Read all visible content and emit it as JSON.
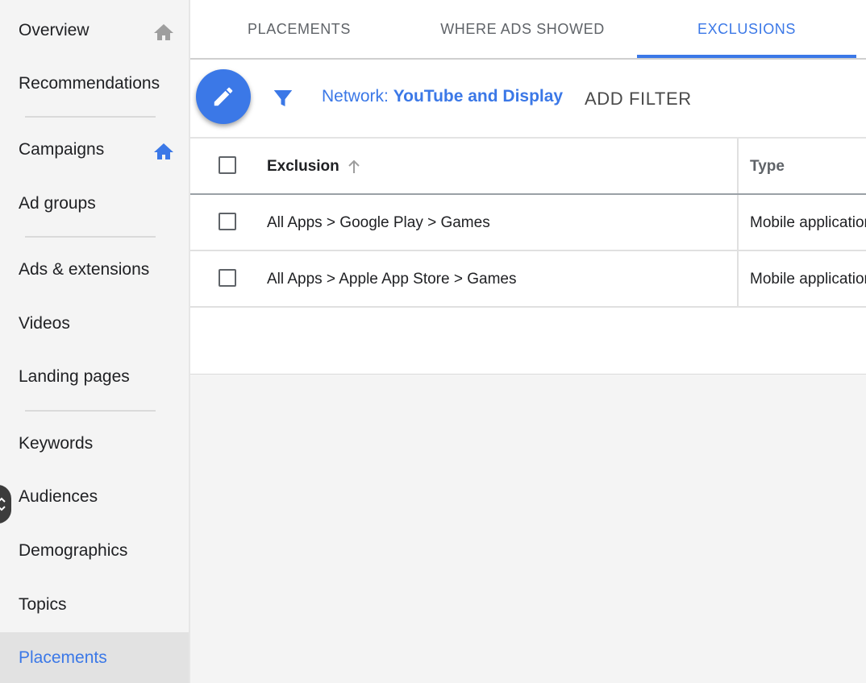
{
  "sidebar": {
    "items": [
      {
        "label": "Overview",
        "icon": "home-icon"
      },
      {
        "label": "Recommendations"
      },
      {
        "label": "Campaigns",
        "icon": "home-icon"
      },
      {
        "label": "Ad groups"
      },
      {
        "label": "Ads & extensions"
      },
      {
        "label": "Videos"
      },
      {
        "label": "Landing pages"
      },
      {
        "label": "Keywords"
      },
      {
        "label": "Audiences"
      },
      {
        "label": "Demographics"
      },
      {
        "label": "Topics"
      },
      {
        "label": "Placements",
        "active": true
      }
    ]
  },
  "tabs": [
    {
      "label": "PLACEMENTS"
    },
    {
      "label": "WHERE ADS SHOWED"
    },
    {
      "label": "EXCLUSIONS",
      "active": true
    }
  ],
  "toolbar": {
    "network_label": "Network:",
    "network_value": "YouTube and Display",
    "add_filter": "ADD FILTER"
  },
  "table": {
    "headers": {
      "exclusion": "Exclusion",
      "type": "Type"
    },
    "rows": [
      {
        "exclusion": "All Apps > Google Play > Games",
        "type": "Mobile application"
      },
      {
        "exclusion": "All Apps > Apple App Store > Games",
        "type": "Mobile application"
      }
    ]
  },
  "colors": {
    "accent": "#3b78e7",
    "sidebar_bg": "#f4f4f4",
    "active_item_bg": "#e2e2e2"
  }
}
